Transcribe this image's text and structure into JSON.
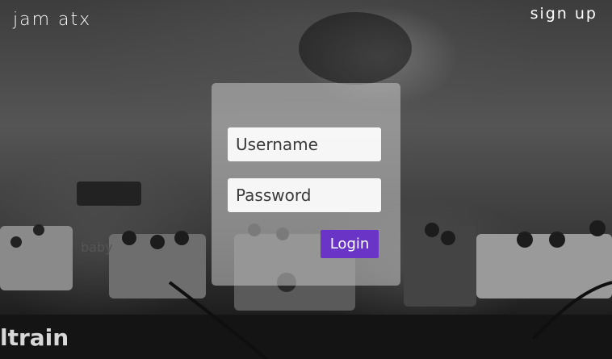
{
  "header": {
    "brand": "jam atx",
    "signup_label": "sign up"
  },
  "background": {
    "pedal_text": "ltrain",
    "pedal_badge": "baby"
  },
  "login_form": {
    "username_placeholder": "Username",
    "password_placeholder": "Password",
    "login_label": "Login"
  },
  "colors": {
    "accent": "#6a35c6",
    "card": "#c8c8c8",
    "text": "#ffffff"
  }
}
